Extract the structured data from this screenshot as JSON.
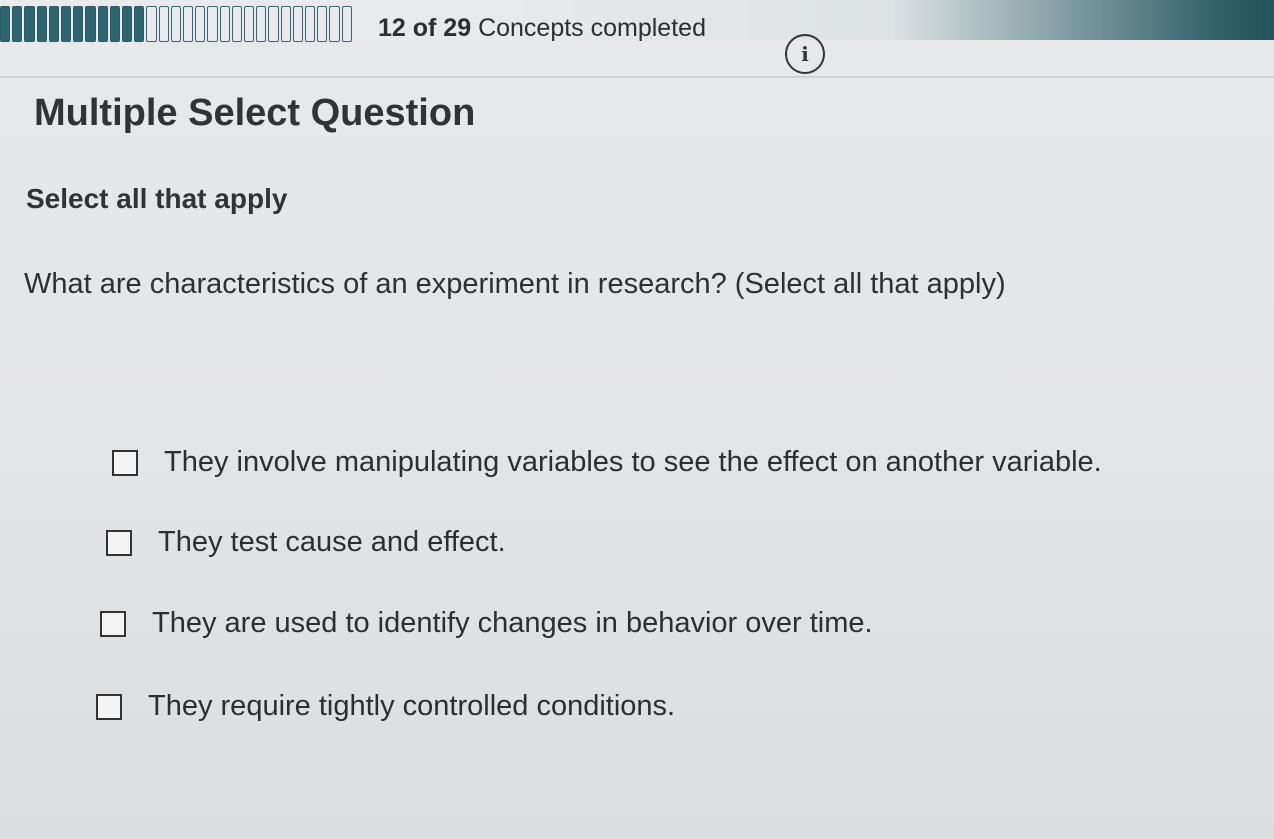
{
  "progress": {
    "completed": 12,
    "total": 29,
    "completed_text": "12 of 29",
    "suffix": "Concepts completed"
  },
  "info_button": {
    "icon": "info-icon",
    "glyph": "i"
  },
  "question": {
    "type": "Multiple Select Question",
    "instructions": "Select all that apply",
    "prompt": "What are characteristics of an experiment in research? (Select all that apply)"
  },
  "options": [
    {
      "label": "They involve manipulating variables to see the effect on another variable.",
      "checked": false
    },
    {
      "label": "They test cause and effect.",
      "checked": false
    },
    {
      "label": "They are used to identify changes in behavior over time.",
      "checked": false
    },
    {
      "label": "They require tightly controlled conditions.",
      "checked": false
    }
  ],
  "colors": {
    "progress_fill": "#2f6570",
    "text": "#2e2e2e",
    "background": "#e4e5e7"
  }
}
